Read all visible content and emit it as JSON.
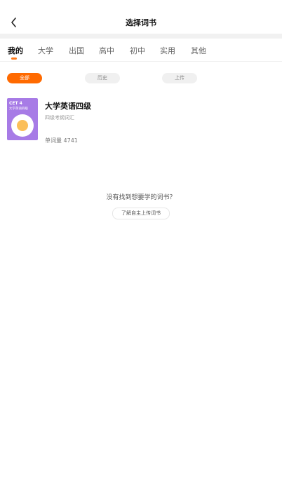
{
  "header": {
    "title": "选择词书",
    "back_icon": "chevron-left-icon"
  },
  "tabs": [
    {
      "label": "我的",
      "active": true
    },
    {
      "label": "大学"
    },
    {
      "label": "出国"
    },
    {
      "label": "高中"
    },
    {
      "label": "初中"
    },
    {
      "label": "实用"
    },
    {
      "label": "其他"
    }
  ],
  "filters": [
    {
      "label": "全部",
      "active": true
    },
    {
      "label": "历史"
    },
    {
      "label": "上传"
    }
  ],
  "books": [
    {
      "cover_badge": "CET 4",
      "cover_title": "大学英语四级",
      "title": "大学英语四级",
      "subtitle": "四级考纲词汇",
      "count_text": "单词量 4741",
      "cover_color": "#a77be6"
    }
  ],
  "empty": {
    "question": "没有找到想要学的词书？",
    "button": "了解自主上传词书"
  },
  "colors": {
    "accent": "#ff6a00"
  }
}
